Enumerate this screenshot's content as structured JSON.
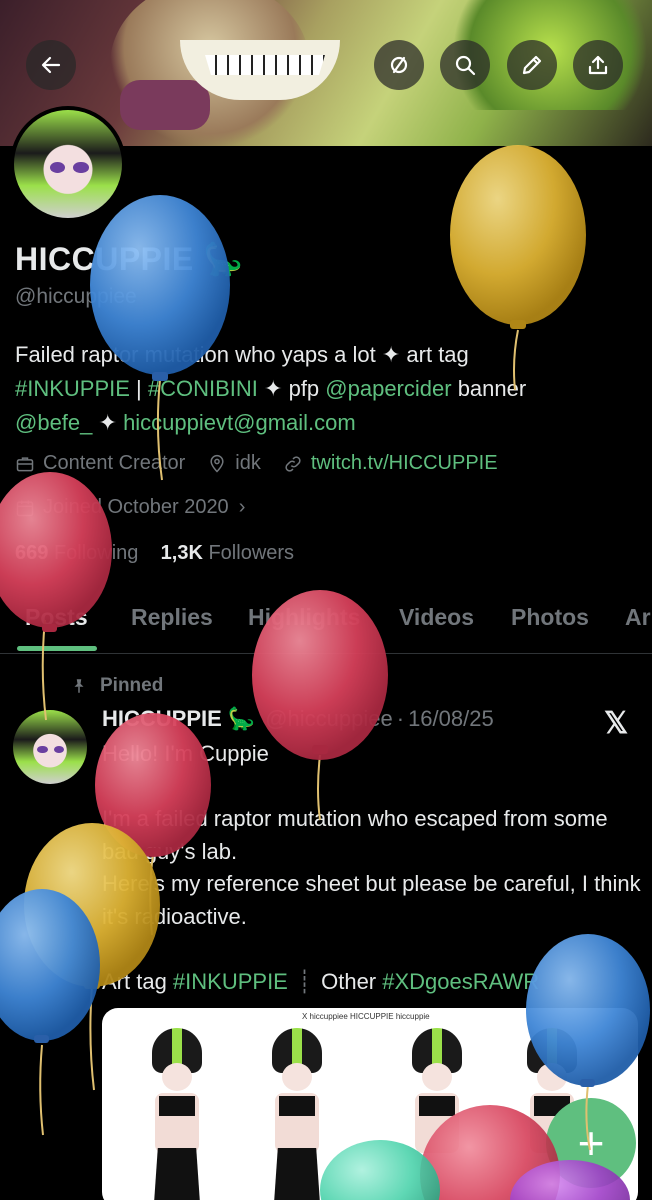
{
  "header": {
    "back_icon": "arrow-left-icon",
    "actions": [
      "hide-icon",
      "search-icon",
      "edit-icon",
      "share-icon"
    ]
  },
  "profile": {
    "name": "HICCUPPIE",
    "name_emoji": "🦕",
    "handle": "@hiccuppiee",
    "bio_line1_text": "Failed raptor mutation who yaps a lot ✦ art tag",
    "bio_tag1": "#INKUPPIE",
    "bio_sep": " | ",
    "bio_tag2": "#CONIBINI",
    "bio_mid": " ✦ pfp ",
    "bio_mention1": "@papercider",
    "bio_mid2": " banner",
    "bio_mention2": "@befe_",
    "bio_mid3": " ✦ ",
    "bio_email": "hiccuppievt@gmail.com",
    "category": "Content Creator",
    "location": "idk",
    "website": "twitch.tv/HICCUPPIE",
    "joined": "Joined October 2020",
    "following_count": "669",
    "following_label": "Following",
    "followers_count": "1,3K",
    "followers_label": "Followers"
  },
  "tabs": [
    "Posts",
    "Replies",
    "Highlights",
    "Videos",
    "Photos",
    "Ar"
  ],
  "post": {
    "pinned_label": "Pinned",
    "author_name": "HICCUPPIE",
    "author_emoji": "🦕",
    "author_handle": "@hiccuppiee",
    "dot": "·",
    "date": "16/08/25",
    "x_logo": "𝕏",
    "line1": "Hello! I'm Cuppie",
    "para2": "I'm a failed raptor mutation who escaped from some bad guy's lab.\nHere's my reference sheet but please be careful, I think it's radioactive.",
    "art_tag_label": "Art tag ",
    "art_tag": "#INKUPPIE",
    "sep": "┊",
    "other_label": "Other ",
    "other_tag": "#XDgoesRAWR",
    "media_header": "X hiccuppiee   HICCUPPIE   hiccuppie"
  },
  "fab_label": "+",
  "balloon_colors": [
    "#4a8fd8",
    "#e0b436",
    "#d9475f",
    "#55d6b0",
    "#a040c8"
  ]
}
